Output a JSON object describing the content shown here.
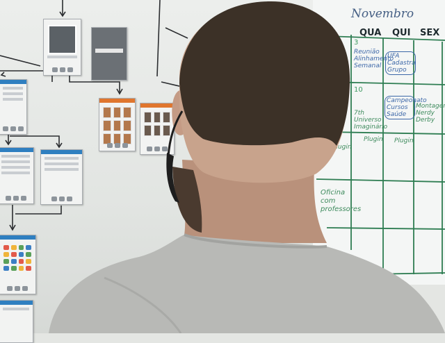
{
  "calendar": {
    "month": "Novembro",
    "days": [
      "QUA",
      "QUI",
      "SEX"
    ],
    "day_numbers": [
      "3",
      "10"
    ],
    "notes": [
      "Reunião Alinhamento Semanal",
      "UFA Cadastra Grupo",
      "7th Universo Imaginário",
      "Campeonato Cursos Saúde",
      "Montagem Nerdy Derby",
      "Plugin",
      "Plugin",
      "Plugin",
      "Oficina com professores"
    ]
  },
  "colors": {
    "marker_green": "#2e7d52",
    "marker_blue": "#3c67a8",
    "card_accent_blue": "#2f7fc0",
    "card_accent_orange": "#e0762e",
    "shirt": "#b8b9b6",
    "hair": "#3c3127"
  }
}
